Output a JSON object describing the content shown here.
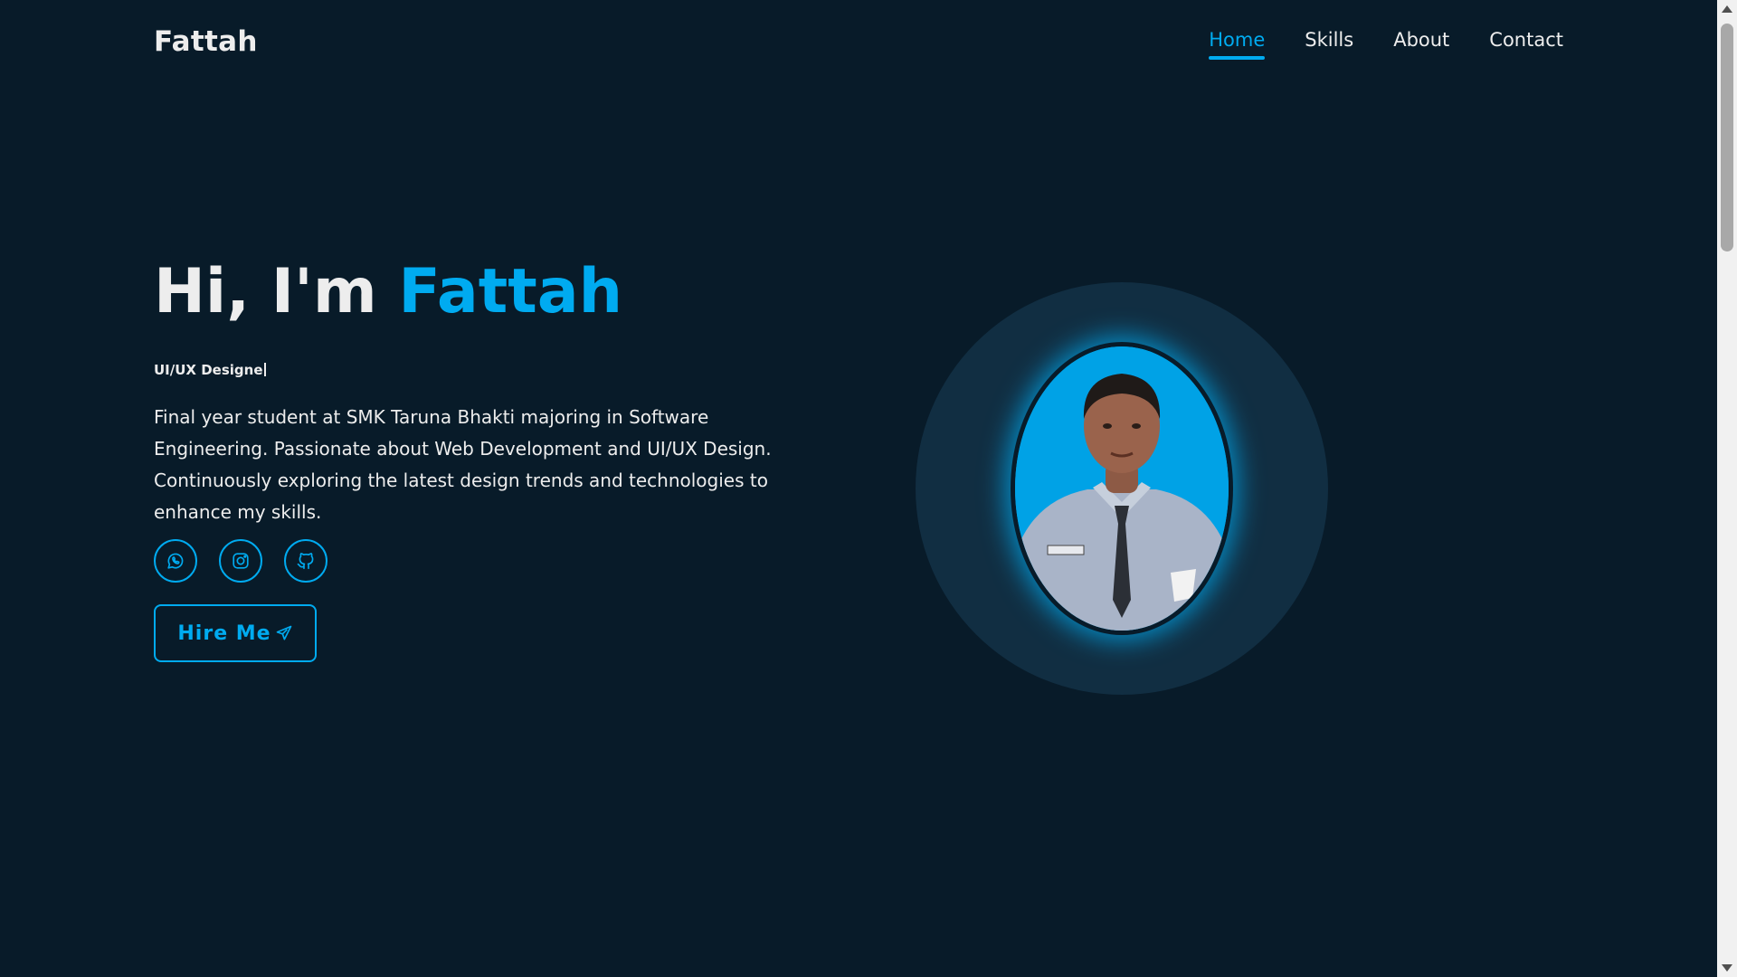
{
  "header": {
    "logo": "Fattah",
    "nav": [
      {
        "label": "Home",
        "active": true
      },
      {
        "label": "Skills",
        "active": false
      },
      {
        "label": "About",
        "active": false
      },
      {
        "label": "Contact",
        "active": false
      }
    ]
  },
  "hero": {
    "greeting": "Hi, I'm",
    "name": "Fattah",
    "role": "UI/UX Designe",
    "description": "Final year student at SMK Taruna Bhakti majoring in Software Engineering. Passionate about Web Development and UI/UX Design. Continuously exploring the latest design trends and technologies to enhance my skills.",
    "socials": [
      {
        "icon": "whatsapp-icon"
      },
      {
        "icon": "instagram-icon"
      },
      {
        "icon": "github-icon"
      }
    ],
    "hire_label": "Hire Me",
    "hire_icon": "send-icon"
  },
  "profile_photo": {
    "subject": "portrait photo"
  },
  "colors": {
    "background": "#081b29",
    "accent": "#00abf0",
    "text": "#ededed",
    "photo_ring": "#112e42"
  }
}
